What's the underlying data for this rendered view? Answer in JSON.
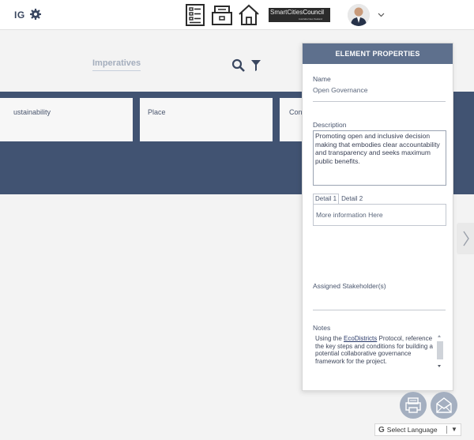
{
  "header": {
    "brand_fragment": "IG",
    "logo": {
      "main_a": "SmartCities",
      "main_b": "Council",
      "sub": "Australia New Zealand"
    }
  },
  "toolbar": {
    "imperatives_label": "Imperatives"
  },
  "imperatives": {
    "cards": [
      "ustainability",
      "Place",
      "Cont"
    ]
  },
  "panel": {
    "title": "ELEMENT PROPERTIES",
    "name_label": "Name",
    "name_value": "Open Governance",
    "description_label": "Description",
    "description_value": "Promoting open and inclusive decision making that embodies clear accountability and transparency and seeks maximum public benefits.",
    "tabs": [
      "Detail 1",
      "Detail 2"
    ],
    "detail_value": "More information Here",
    "stakeholders_label": "Assigned Stakeholder(s)",
    "notes_label": "Notes",
    "notes_prefix": "Using the ",
    "notes_link": "EcoDistricts",
    "notes_suffix": " Protocol, reference the key steps and conditions for building a potential collaborative governance framework for the project."
  },
  "language": {
    "label": "Select Language",
    "arrow": "▼"
  },
  "colors": {
    "band": "#415372",
    "panel_header": "#5e708d",
    "round_button": "#a4afc0"
  },
  "icons": [
    "gear-icon",
    "checklist-icon",
    "inbox-tray-icon",
    "home-icon",
    "user-avatar",
    "chevron-down-icon",
    "search-icon",
    "filter-icon",
    "chevron-right-icon",
    "print-icon",
    "mail-icon",
    "google-g-icon"
  ]
}
